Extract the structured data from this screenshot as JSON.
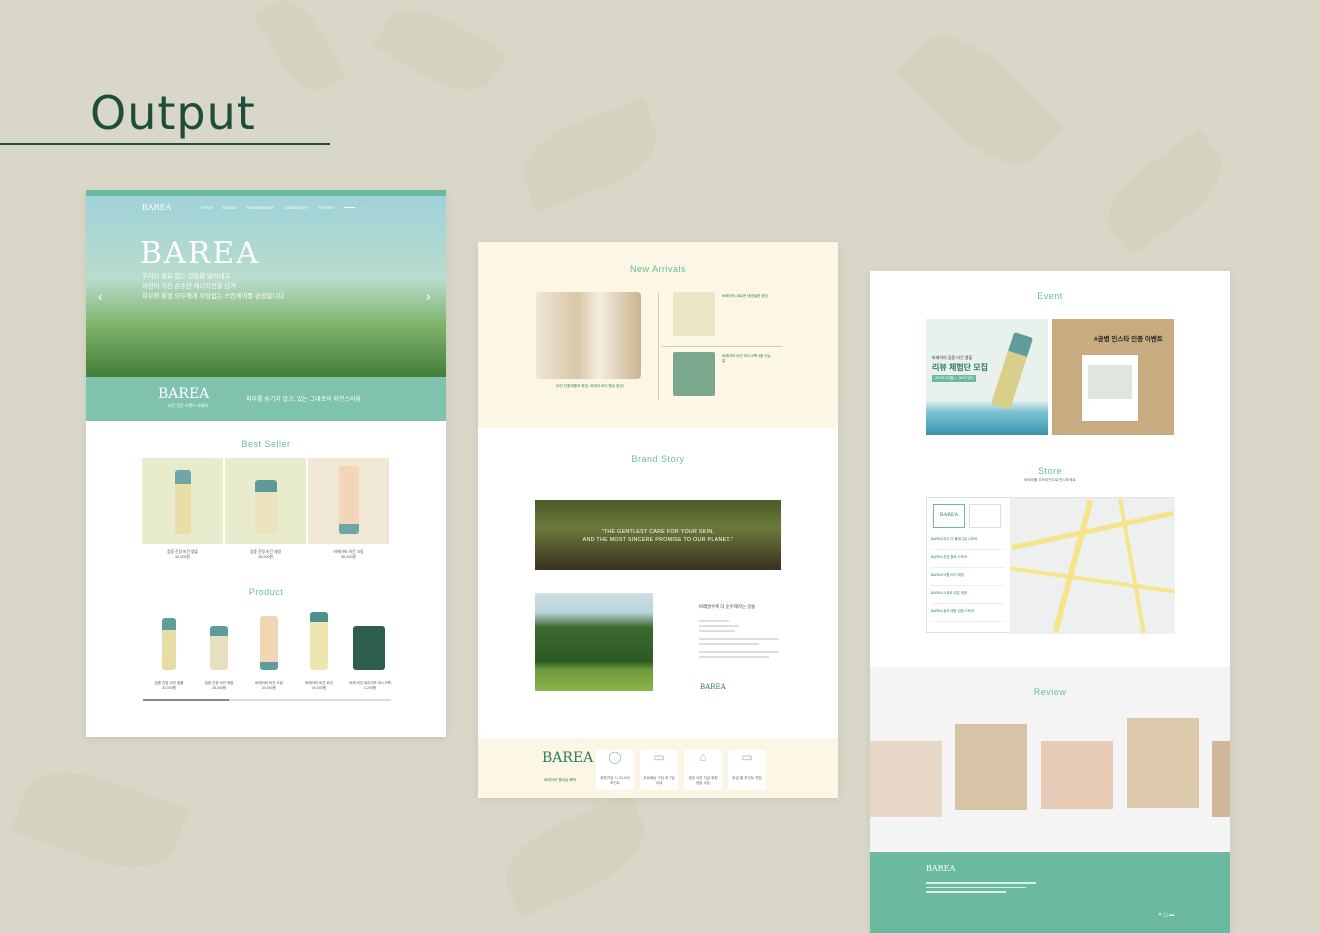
{
  "heading": "Output",
  "panel1": {
    "top_strip": "",
    "logo": "BAREA",
    "nav": [
      "SHOP",
      "BRAND",
      "MEMBERSHIP",
      "COMMUNITY",
      "REVIEW"
    ],
    "hero_brand": "BAREA",
    "hero_copy": [
      "우리는 필요 없는 것들을 덜어내고",
      "자연이 가진 순수한 에너지만을 남겨",
      "피부와 환경 모두에게 부담없는 스킨케어를 완성합니다."
    ],
    "band_logo": "BAREA",
    "band_sub": "비건 전문 브랜드 바레아",
    "band_tagline": "피부를 숨기지 않고, 있는 그대로의 자연스러움",
    "best_seller_title": "Best Seller",
    "best_items": [
      {
        "name": "집중 진정 비건 앰플",
        "price": "32,000원"
      },
      {
        "name": "집중 진정 비건 세럼",
        "price": "28,000원"
      },
      {
        "name": "바레아비 비건 크림",
        "price": "30,000원"
      }
    ],
    "product_title": "Product",
    "products": [
      {
        "name": "집중 진정 비건 앰플",
        "price": "32,000원"
      },
      {
        "name": "집중 진정 비건 세럼",
        "price": "28,000원"
      },
      {
        "name": "바레아비 비건 크림",
        "price": "30,000원"
      },
      {
        "name": "바레아비 비건 로션",
        "price": "40,000원"
      },
      {
        "name": "바레 비건 퓨어리프 마스크팩",
        "price": "1,200원"
      }
    ]
  },
  "panel2": {
    "new_arrivals_title": "New Arrivals",
    "na_main_caption": "비건 인증제품의 확장, 바레아 비디 향상 완성!",
    "na_item1": "바레아의 새로운 에센셜한 완성",
    "na_item2": "바레아의 비건 마스크팩 3종 리뉴얼",
    "brand_story_title": "Brand Story",
    "quote": [
      "\"THE GENTLEST CARE FOR YOUR SKIN,",
      "AND THE MOST SINCERE PROMISE TO OUR PLANET.\""
    ],
    "story_heading": "바레알수록 더 순수해지는 것들",
    "story_logo": "BAREA",
    "footer_logo": "BAREA",
    "footer_link": "바레아의 멤버십 혜택",
    "benefits": [
      {
        "label": "회원가입 시 30,000 포인트"
      },
      {
        "label": "무료배송 구입 후 7일 이내"
      },
      {
        "label": "생일 쿠폰 지급 회원 생일 쿠폰"
      },
      {
        "label": "등급 별 포인트 적립"
      }
    ]
  },
  "panel3": {
    "event_title": "Event",
    "event1": {
      "headline": "리뷰 체험단 모집",
      "sub": "바레아의 집중 비건 앰플",
      "dates": "25.09.01(월) ~ 09.27(토)"
    },
    "event2": {
      "headline": "#공병 인스타 인증 이벤트"
    },
    "store_title": "Store",
    "store_sub": "바레아를 오프라인으로 만나보세요",
    "store_rows": [
      "BAREA 파주 더 플래그십 스토어",
      "BAREA 천호 점포 스토어",
      "BAREA 낙원 리더 매장",
      "BAREA 스포트 리븐 매장",
      "BAREA 동국 매장 입점 스토어"
    ],
    "review_title": "Review",
    "footer_logo": "BAREA"
  },
  "colors": {
    "accent": "#6bb9a0",
    "dark_green": "#1f4d3a",
    "background": "#d9d7c8"
  }
}
